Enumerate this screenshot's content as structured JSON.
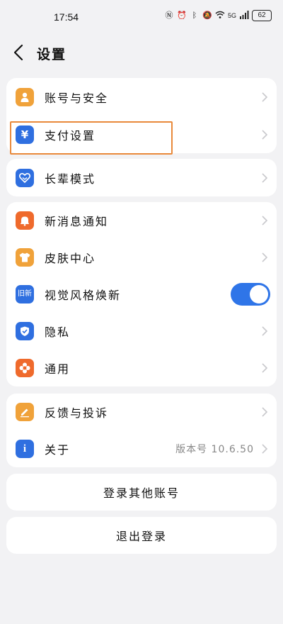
{
  "status": {
    "time": "17:54",
    "network": "5G",
    "battery": "62"
  },
  "header": {
    "title": "设置"
  },
  "groups": [
    {
      "items": [
        {
          "label": "账号与安全",
          "icon": "person-icon",
          "color": "#f0a23a"
        },
        {
          "label": "支付设置",
          "icon": "yuan-icon",
          "color": "#2f6fe0"
        }
      ]
    },
    {
      "items": [
        {
          "label": "长辈模式",
          "icon": "heart-icon",
          "color": "#2f6fe0"
        }
      ]
    },
    {
      "items": [
        {
          "label": "新消息通知",
          "icon": "bell-icon",
          "color": "#ef6a2c"
        },
        {
          "label": "皮肤中心",
          "icon": "tshirt-icon",
          "color": "#f0a23a"
        },
        {
          "label": "视觉风格焕新",
          "icon": "style-icon",
          "color": "#2f6fe0",
          "toggle": true,
          "toggle_on": true,
          "icon_text": "旧新"
        },
        {
          "label": "隐私",
          "icon": "shield-icon",
          "color": "#2f6fe0"
        },
        {
          "label": "通用",
          "icon": "flower-icon",
          "color": "#ef6a2c"
        }
      ]
    },
    {
      "items": [
        {
          "label": "反馈与投诉",
          "icon": "pencil-icon",
          "color": "#f0a23a"
        },
        {
          "label": "关于",
          "icon": "info-icon",
          "color": "#2f6fe0",
          "value": "版本号 10.6.50"
        }
      ]
    }
  ],
  "actions": {
    "switch_account": "登录其他账号",
    "logout": "退出登录"
  },
  "highlight_color": "#e9893a"
}
